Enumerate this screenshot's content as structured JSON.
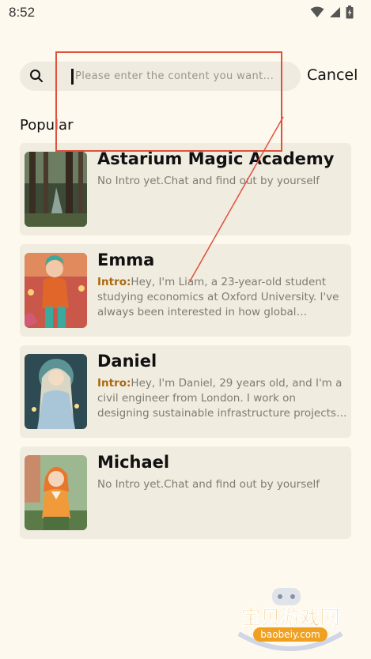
{
  "status_bar": {
    "time": "8:52"
  },
  "search": {
    "placeholder": "Please enter the content you want...",
    "value": "",
    "cancel_label": "Cancel"
  },
  "section": {
    "title": "Popular"
  },
  "cards": [
    {
      "name": "Astarium Magic Academy",
      "intro_label": "",
      "description": "No Intro yet.Chat and find out by yourself"
    },
    {
      "name": "Emma",
      "intro_label": "Intro:",
      "description": "Hey, I'm Liam, a 23-year-old student studying economics at Oxford University. I've always been interested in how global market..."
    },
    {
      "name": "Daniel",
      "intro_label": "Intro:",
      "description": "Hey, I'm Daniel, 29 years old, and I'm a civil engineer from London. I work on designing sustainable infrastructure projects ..."
    },
    {
      "name": "Michael",
      "intro_label": "",
      "description": "No Intro yet.Chat and find out by yourself"
    }
  ],
  "watermark": {
    "cn": "宝贝游戏网",
    "url": "baobeiy.com"
  },
  "colors": {
    "background": "#fdf9ee",
    "card": "#f1ece0",
    "intro": "#a8680d",
    "annotation": "#e0513b"
  }
}
